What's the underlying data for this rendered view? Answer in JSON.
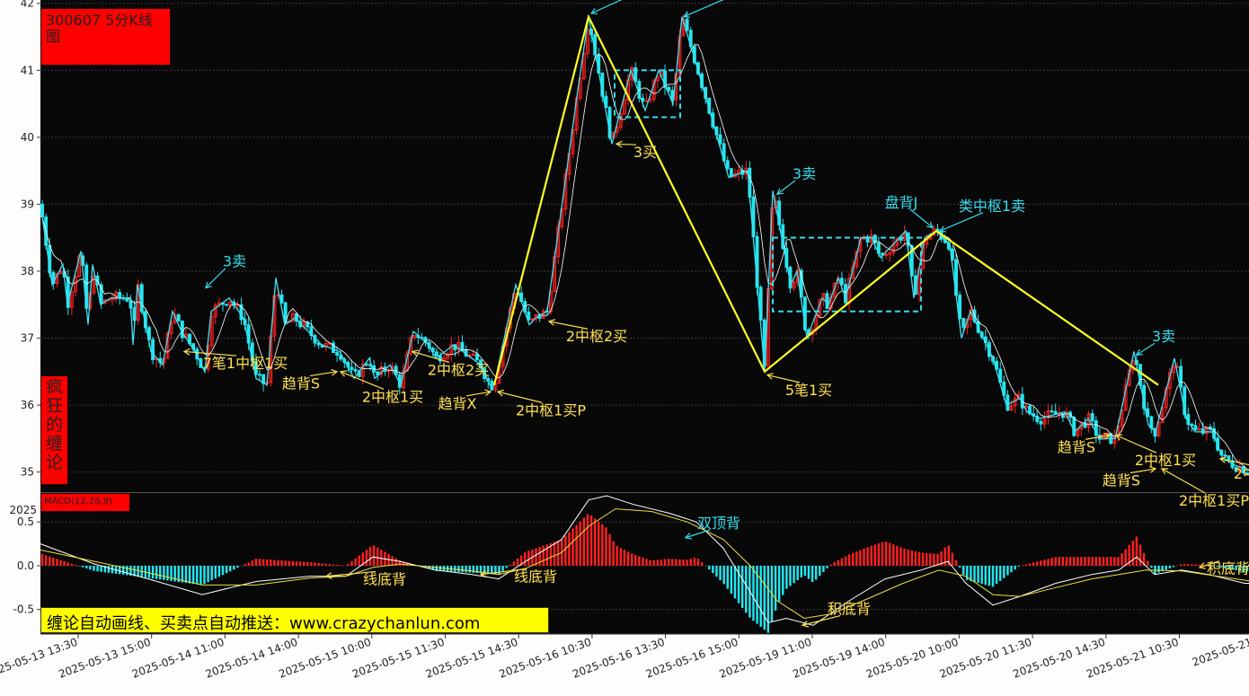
{
  "chart_title": "300607 5分K线图",
  "side_label": [
    "疯",
    "狂",
    "的",
    "缠",
    "论"
  ],
  "macd_label": "MACD(12,26,9)",
  "promo_text": "缠论自动画线、买卖点自动推送：www.crazychanlun.com",
  "colors": {
    "background": "#080808",
    "up": "#ff2020",
    "down": "#22e6f0",
    "stroke_line": "#3fe0f0",
    "segment_line": "#ffff22",
    "ma_line": "#ffffff",
    "zone_box": "#33ddee",
    "buy_annotation": "#ffe050",
    "sell_annotation": "#33ddee",
    "badge_red": "#ff0000",
    "promo_yellow": "#ffff00"
  },
  "chart_data": [
    {
      "type": "candlestick",
      "ylim": [
        34.7,
        42.05
      ],
      "y_ticks": [
        "35",
        "36",
        "37",
        "38",
        "39",
        "40",
        "41",
        "42"
      ],
      "x_ticks": [
        "2025-05-13 13:30",
        "2025-05-13 15:00",
        "2025-05-14 11:00",
        "2025-05-14 14:00",
        "2025-05-15 10:00",
        "2025-05-15 11:30",
        "2025-05-15 14:30",
        "2025-05-16 10:30",
        "2025-05-16 13:30",
        "2025-05-16 15:00",
        "2025-05-19 11:00",
        "2025-05-19 14:00",
        "2025-05-20 10:00",
        "2025-05-20 11:30",
        "2025-05-20 14:30",
        "2025-05-21 10:30",
        "2025-05-21"
      ],
      "bars_count": 328,
      "stroke_points": [
        [
          0,
          39.0
        ],
        [
          13,
          37.8
        ],
        [
          25,
          38.1
        ],
        [
          30,
          37.5
        ],
        [
          45,
          38.3
        ],
        [
          53,
          37.2
        ],
        [
          58,
          38.1
        ],
        [
          67,
          37.5
        ],
        [
          78,
          37.6
        ],
        [
          100,
          37.6
        ],
        [
          103,
          36.9
        ],
        [
          108,
          37.8
        ],
        [
          123,
          36.8
        ],
        [
          136,
          36.6
        ],
        [
          147,
          37.4
        ],
        [
          157,
          37.1
        ],
        [
          172,
          36.8
        ],
        [
          183,
          36.5
        ],
        [
          190,
          37.4
        ],
        [
          210,
          37.6
        ],
        [
          226,
          37.3
        ],
        [
          240,
          36.4
        ],
        [
          252,
          36.3
        ],
        [
          262,
          37.9
        ],
        [
          272,
          37.2
        ],
        [
          283,
          37.3
        ],
        [
          313,
          36.9
        ],
        [
          333,
          36.8
        ],
        [
          349,
          36.4
        ],
        [
          366,
          36.7
        ],
        [
          372,
          36.4
        ],
        [
          389,
          36.6
        ],
        [
          401,
          36.3
        ],
        [
          415,
          37.1
        ],
        [
          432,
          36.9
        ],
        [
          440,
          36.7
        ],
        [
          460,
          36.9
        ],
        [
          490,
          36.6
        ],
        [
          500,
          36.3
        ],
        [
          505,
          36.3
        ],
        [
          529,
          37.8
        ],
        [
          544,
          37.2
        ],
        [
          551,
          37.3
        ],
        [
          564,
          37.4
        ],
        [
          598,
          40.7
        ],
        [
          610,
          41.8
        ],
        [
          636,
          39.9
        ],
        [
          657,
          41.0
        ],
        [
          673,
          40.4
        ],
        [
          688,
          41.0
        ],
        [
          704,
          40.5
        ],
        [
          714,
          41.8
        ],
        [
          734,
          40.9
        ],
        [
          766,
          39.4
        ],
        [
          787,
          39.5
        ],
        [
          806,
          36.5
        ],
        [
          815,
          39.2
        ],
        [
          835,
          37.8
        ],
        [
          842,
          38.0
        ],
        [
          853,
          37.0
        ],
        [
          870,
          37.6
        ],
        [
          877,
          37.5
        ],
        [
          888,
          37.9
        ],
        [
          896,
          37.6
        ],
        [
          913,
          38.5
        ],
        [
          925,
          38.5
        ],
        [
          935,
          38.2
        ],
        [
          963,
          38.6
        ],
        [
          972,
          37.6
        ],
        [
          984,
          38.5
        ],
        [
          997,
          38.6
        ],
        [
          1012,
          38.4
        ],
        [
          1025,
          37.0
        ],
        [
          1035,
          37.4
        ],
        [
          1060,
          36.7
        ],
        [
          1075,
          36.0
        ],
        [
          1090,
          36.1
        ],
        [
          1098,
          35.9
        ],
        [
          1112,
          35.8
        ],
        [
          1140,
          35.9
        ],
        [
          1151,
          35.6
        ],
        [
          1166,
          35.8
        ],
        [
          1179,
          35.5
        ],
        [
          1196,
          35.5
        ],
        [
          1217,
          36.8
        ],
        [
          1233,
          35.7
        ],
        [
          1241,
          35.6
        ],
        [
          1262,
          36.7
        ],
        [
          1275,
          35.8
        ],
        [
          1285,
          35.6
        ],
        [
          1304,
          35.6
        ],
        [
          1316,
          35.2
        ],
        [
          1330,
          35.1
        ],
        [
          1350,
          35.0
        ],
        [
          1366,
          35.1
        ],
        [
          1390,
          35.0
        ]
      ],
      "segment_points": [
        [
          505,
          36.3
        ],
        [
          610,
          41.8
        ],
        [
          806,
          36.5
        ],
        [
          997,
          38.6
        ],
        [
          1244,
          36.3
        ]
      ],
      "zones": [
        {
          "x": [
            639,
            712
          ],
          "y": [
            40.3,
            41.0
          ]
        },
        {
          "x": [
            815,
            980
          ],
          "y": [
            37.4,
            38.5
          ]
        }
      ],
      "annotations": [
        {
          "text": "3卖",
          "kind": "sell",
          "x": 216,
          "y": 38.07,
          "tx": 184,
          "ty": 37.75
        },
        {
          "text": "7笔1中枢1买",
          "kind": "buy",
          "x": 228,
          "y": 36.55,
          "tx": 160,
          "ty": 36.8
        },
        {
          "text": "趋背S",
          "kind": "buy",
          "x": 290,
          "y": 36.25,
          "tx": 330,
          "ty": 36.5
        },
        {
          "text": "2中枢1买",
          "kind": "buy",
          "x": 392,
          "y": 36.05,
          "tx": 334,
          "ty": 36.5
        },
        {
          "text": "2中枢2买",
          "kind": "buy",
          "x": 465,
          "y": 36.45,
          "tx": 414,
          "ty": 36.8
        },
        {
          "text": "趋背X",
          "kind": "buy",
          "x": 464,
          "y": 35.95,
          "tx": 501,
          "ty": 36.2
        },
        {
          "text": "2中枢1买P",
          "kind": "buy",
          "x": 568,
          "y": 35.85,
          "tx": 509,
          "ty": 36.2
        },
        {
          "text": "2中枢2买",
          "kind": "buy",
          "x": 619,
          "y": 36.95,
          "tx": 566,
          "ty": 37.25
        },
        {
          "text": "3买",
          "kind": "buy",
          "x": 673,
          "y": 39.7,
          "tx": 641,
          "ty": 39.9
        },
        {
          "text": "类中枢1卖",
          "kind": "sell",
          "x": 668,
          "y": 42.15,
          "tx": 613,
          "ty": 41.85
        },
        {
          "text": "类中枢1卖",
          "kind": "sell",
          "x": 773,
          "y": 42.1,
          "tx": 716,
          "ty": 41.8
        },
        {
          "text": "3卖",
          "kind": "sell",
          "x": 850,
          "y": 39.38,
          "tx": 820,
          "ty": 39.15
        },
        {
          "text": "5笔1买",
          "kind": "buy",
          "x": 855,
          "y": 36.15,
          "tx": 809,
          "ty": 36.45
        },
        {
          "text": "盘背J",
          "kind": "sell",
          "x": 958,
          "y": 38.95,
          "tx": 993,
          "ty": 38.65
        },
        {
          "text": "类中枢1卖",
          "kind": "sell",
          "x": 1059,
          "y": 38.9,
          "tx": 1001,
          "ty": 38.6
        },
        {
          "text": "3卖",
          "kind": "sell",
          "x": 1250,
          "y": 36.95,
          "tx": 1220,
          "ty": 36.75
        },
        {
          "text": "趋背S",
          "kind": "buy",
          "x": 1153,
          "y": 35.3,
          "tx": 1190,
          "ty": 35.55
        },
        {
          "text": "2中枢1买",
          "kind": "buy",
          "x": 1252,
          "y": 35.1,
          "tx": 1197,
          "ty": 35.55
        },
        {
          "text": "趋背S",
          "kind": "buy",
          "x": 1203,
          "y": 34.8,
          "tx": 1241,
          "ty": 35.05
        },
        {
          "text": "2中枢1买P",
          "kind": "buy",
          "x": 1306,
          "y": 34.5,
          "tx": 1248,
          "ty": 35.05
        },
        {
          "text": "2中枢2买",
          "kind": "buy",
          "x": 1362,
          "y": 34.9,
          "tx": 1313,
          "ty": 35.2
        }
      ]
    },
    {
      "type": "macd",
      "ylim": [
        -0.78,
        0.82
      ],
      "y_ticks": [
        "0.5",
        "0.0",
        "-0.5"
      ],
      "y_tick_values": [
        0.5,
        0.0,
        -0.5
      ],
      "extra_label": "2025",
      "dif_points": [
        [
          0,
          0.25
        ],
        [
          60,
          0.02
        ],
        [
          120,
          -0.15
        ],
        [
          180,
          -0.33
        ],
        [
          240,
          -0.18
        ],
        [
          300,
          -0.12
        ],
        [
          340,
          -0.12
        ],
        [
          370,
          0.1
        ],
        [
          400,
          0.05
        ],
        [
          440,
          -0.05
        ],
        [
          480,
          -0.1
        ],
        [
          510,
          -0.15
        ],
        [
          540,
          0.05
        ],
        [
          580,
          0.3
        ],
        [
          610,
          0.75
        ],
        [
          630,
          0.8
        ],
        [
          660,
          0.7
        ],
        [
          700,
          0.6
        ],
        [
          730,
          0.5
        ],
        [
          760,
          0.2
        ],
        [
          790,
          -0.3
        ],
        [
          810,
          -0.65
        ],
        [
          830,
          -0.6
        ],
        [
          860,
          -0.68
        ],
        [
          900,
          -0.4
        ],
        [
          940,
          -0.15
        ],
        [
          980,
          -0.05
        ],
        [
          1010,
          0.05
        ],
        [
          1030,
          -0.2
        ],
        [
          1060,
          -0.45
        ],
        [
          1090,
          -0.35
        ],
        [
          1130,
          -0.2
        ],
        [
          1170,
          -0.1
        ],
        [
          1200,
          -0.05
        ],
        [
          1220,
          0.1
        ],
        [
          1240,
          -0.1
        ],
        [
          1270,
          -0.05
        ],
        [
          1300,
          -0.1
        ],
        [
          1340,
          -0.2
        ],
        [
          1390,
          -0.2
        ]
      ],
      "dea_points": [
        [
          0,
          0.18
        ],
        [
          60,
          0.05
        ],
        [
          120,
          -0.08
        ],
        [
          180,
          -0.22
        ],
        [
          240,
          -0.22
        ],
        [
          300,
          -0.14
        ],
        [
          340,
          -0.12
        ],
        [
          370,
          -0.02
        ],
        [
          400,
          0.02
        ],
        [
          440,
          -0.02
        ],
        [
          480,
          -0.06
        ],
        [
          510,
          -0.1
        ],
        [
          540,
          -0.03
        ],
        [
          580,
          0.15
        ],
        [
          610,
          0.45
        ],
        [
          640,
          0.65
        ],
        [
          680,
          0.62
        ],
        [
          720,
          0.5
        ],
        [
          760,
          0.3
        ],
        [
          790,
          0.0
        ],
        [
          820,
          -0.4
        ],
        [
          850,
          -0.6
        ],
        [
          880,
          -0.55
        ],
        [
          920,
          -0.38
        ],
        [
          960,
          -0.2
        ],
        [
          1000,
          -0.05
        ],
        [
          1030,
          -0.12
        ],
        [
          1060,
          -0.33
        ],
        [
          1090,
          -0.35
        ],
        [
          1130,
          -0.25
        ],
        [
          1170,
          -0.15
        ],
        [
          1200,
          -0.1
        ],
        [
          1230,
          -0.05
        ],
        [
          1270,
          -0.06
        ],
        [
          1310,
          -0.12
        ],
        [
          1350,
          -0.18
        ],
        [
          1390,
          -0.18
        ]
      ],
      "annotations": [
        {
          "text": "线底背",
          "x": 383,
          "y": -0.21,
          "tx": 318,
          "ty": -0.12
        },
        {
          "text": "线底背",
          "x": 551,
          "y": -0.18,
          "tx": 490,
          "ty": -0.1
        },
        {
          "text": "双顶背",
          "x": 755,
          "y": 0.43,
          "tx": 718,
          "ty": 0.32
        },
        {
          "text": "积底背",
          "x": 900,
          "y": -0.55,
          "tx": 848,
          "ty": -0.68
        },
        {
          "text": "积底背",
          "x": 1322,
          "y": -0.09,
          "tx": 1290,
          "ty": -0.02
        }
      ]
    }
  ]
}
